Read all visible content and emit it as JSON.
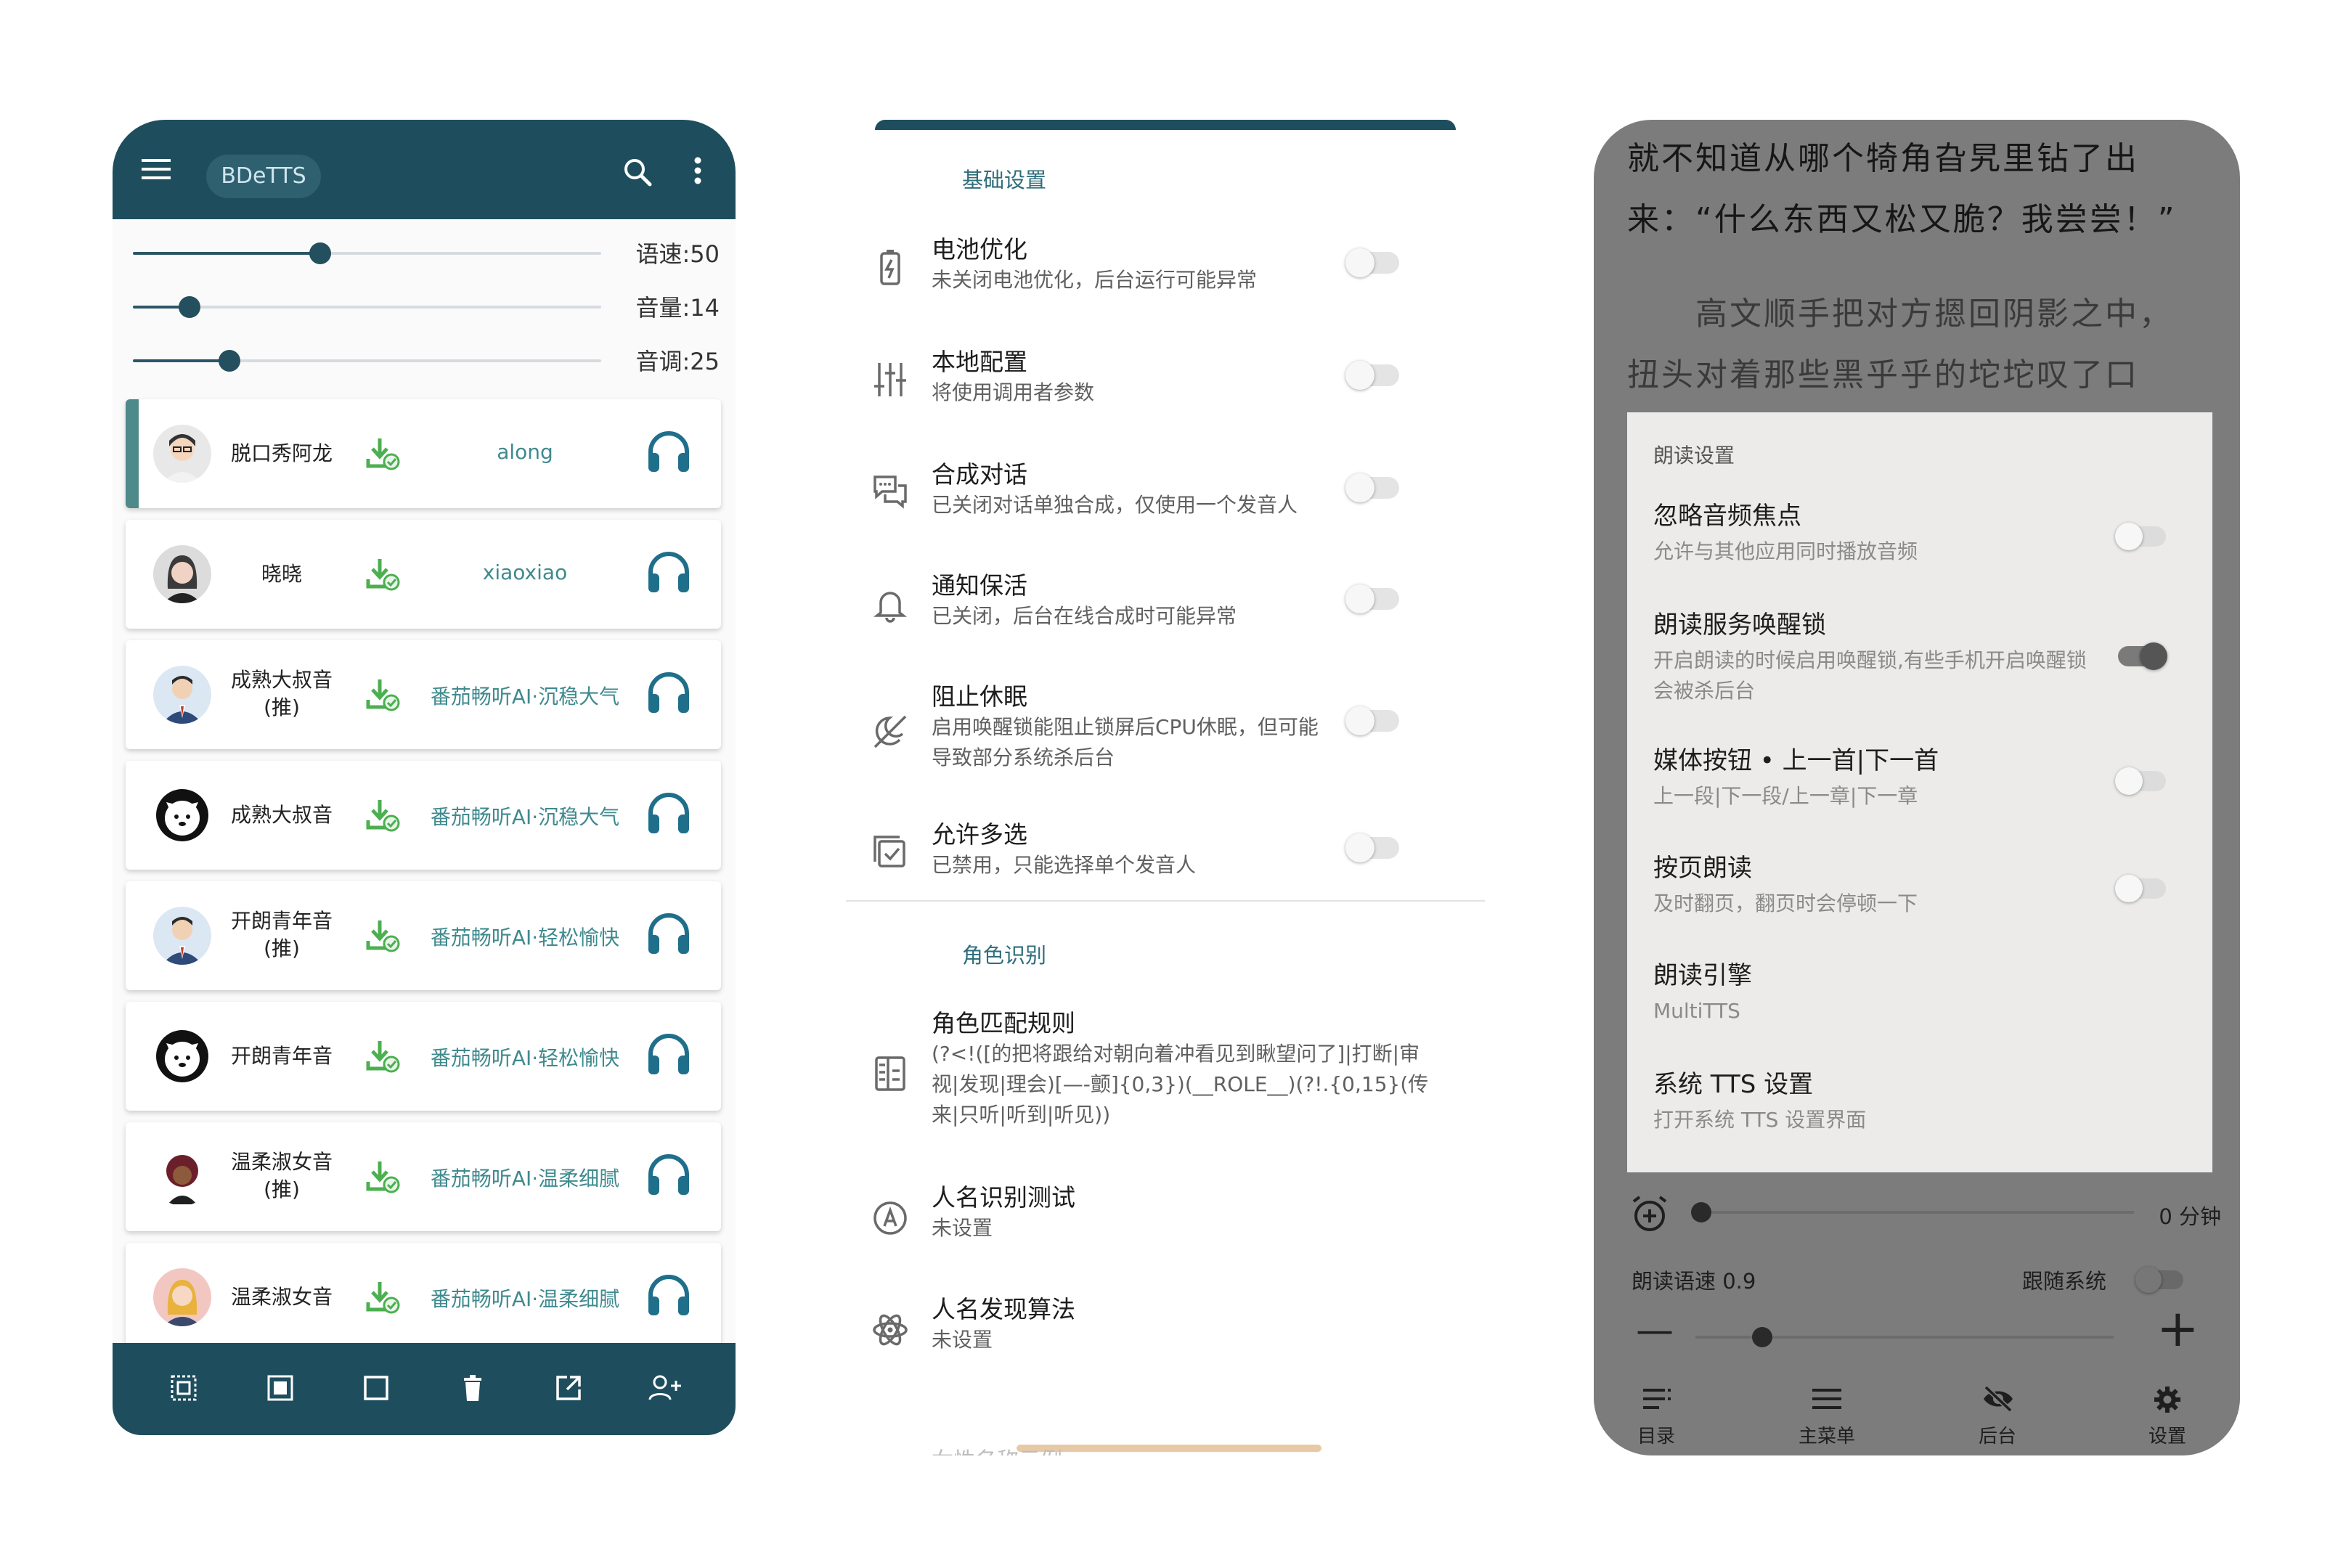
{
  "phone1": {
    "app_title": "BDeTTS",
    "sliders": [
      {
        "label": "语速:50",
        "value": 50,
        "max": 100
      },
      {
        "label": "音量:14",
        "value": 14,
        "max": 100
      },
      {
        "label": "音调:25",
        "value": 25,
        "max": 100
      }
    ],
    "voices": [
      {
        "name": "脱口秀阿龙",
        "id": "along",
        "avatar": "man-glasses",
        "selected": true
      },
      {
        "name": "晓晓",
        "id": "xiaoxiao",
        "avatar": "woman-dark-hair",
        "selected": false
      },
      {
        "name": "成熟大叔音\n(推)",
        "id": "番茄畅听AI·沉稳大气",
        "avatar": "man-suit",
        "selected": false
      },
      {
        "name": "成熟大叔音",
        "id": "番茄畅听AI·沉稳大气",
        "avatar": "shiba-dog",
        "selected": false
      },
      {
        "name": "开朗青年音\n(推)",
        "id": "番茄畅听AI·轻松愉快",
        "avatar": "man-suit",
        "selected": false
      },
      {
        "name": "开朗青年音",
        "id": "番茄畅听AI·轻松愉快",
        "avatar": "shiba-dog",
        "selected": false
      },
      {
        "name": "温柔淑女音\n(推)",
        "id": "番茄畅听AI·温柔细腻",
        "avatar": "woman-curly",
        "selected": false
      },
      {
        "name": "温柔淑女音",
        "id": "番茄畅听AI·温柔细腻",
        "avatar": "woman-blonde",
        "selected": false
      }
    ],
    "bottom_icons": [
      "select-all-icon",
      "select-inverse-icon",
      "deselect-icon",
      "delete-icon",
      "export-icon",
      "add-voice-icon"
    ],
    "colors": {
      "primary": "#1e4e5d",
      "accent": "#3f8a8e",
      "download": "#4caf50",
      "headphone": "#1f6f8b"
    }
  },
  "phone2": {
    "sections": [
      {
        "header": "基础设置",
        "items": [
          {
            "title": "电池优化",
            "subtitle": "未关闭电池优化，后台运行可能异常",
            "icon": "battery-icon",
            "toggle": false
          },
          {
            "title": "本地配置",
            "subtitle": "将使用调用者参数",
            "icon": "tune-icon",
            "toggle": false
          },
          {
            "title": "合成对话",
            "subtitle": "已关闭对话单独合成，仅使用一个发音人",
            "icon": "chat-icon",
            "toggle": false
          },
          {
            "title": "通知保活",
            "subtitle": "已关闭，后台在线合成时可能异常",
            "icon": "bell-icon",
            "toggle": false
          },
          {
            "title": "阻止休眠",
            "subtitle": "启用唤醒锁能阻止锁屏后CPU休眠，但可能导致部分系统杀后台",
            "icon": "sleep-off-icon",
            "toggle": false
          },
          {
            "title": "允许多选",
            "subtitle": "已禁用，只能选择单个发音人",
            "icon": "checkbox-icon",
            "toggle": false
          }
        ]
      },
      {
        "header": "角色识别",
        "items": [
          {
            "title": "角色匹配规则",
            "subtitle": "(?<!([的把将跟给对朝向着冲看见到瞅望问了]|打断|审视|发现|理会)[—-颤]{0,3})(__ROLE__)(?!.{0,15}(传来|只听|听到|听见))",
            "icon": "rules-icon"
          },
          {
            "title": "人名识别测试",
            "subtitle": "未设置",
            "icon": "name-test-icon"
          },
          {
            "title": "人名发现算法",
            "subtitle": "未设置",
            "icon": "atom-icon"
          }
        ]
      }
    ],
    "cut_text": "女性名称示例"
  },
  "phone3": {
    "reader_lines": [
      "就不知道从哪个犄角旮旯里钻了出",
      "来：“什么东西又松又脆？我尝尝！”",
      "　　高文顺手把对方摁回阴影之中，",
      "扭头对着那些黑乎乎的坨坨叹了口"
    ],
    "sheet_header": "朗读设置",
    "sheet_items": [
      {
        "title": "忽略音频焦点",
        "subtitle": "允许与其他应用同时播放音频",
        "toggle": false
      },
      {
        "title": "朗读服务唤醒锁",
        "subtitle": "开启朗读的时候启用唤醒锁,有些手机开启唤醒锁会被杀后台",
        "toggle": true
      },
      {
        "title": "媒体按钮 • 上一首|下一首",
        "subtitle": "上一段|下一段/上一章|下一章",
        "toggle": false
      },
      {
        "title": "按页朗读",
        "subtitle": "及时翻页，翻页时会停顿一下",
        "toggle": false
      },
      {
        "title": "朗读引擎",
        "subtitle": "MultiTTS"
      },
      {
        "title": "系统 TTS 设置",
        "subtitle": "打开系统 TTS 设置界面"
      }
    ],
    "timer_label": "0 分钟",
    "timer_value": 0,
    "speed_label": "朗读语速 0.9",
    "speed_value": 0.9,
    "follow_system_label": "跟随系统",
    "follow_system": false,
    "minus_symbol": "—",
    "plus_symbol": "+",
    "nav": [
      {
        "label": "目录",
        "icon": "toc-icon"
      },
      {
        "label": "主菜单",
        "icon": "menu-icon"
      },
      {
        "label": "后台",
        "icon": "eye-off-icon"
      },
      {
        "label": "设置",
        "icon": "gear-icon"
      }
    ]
  }
}
